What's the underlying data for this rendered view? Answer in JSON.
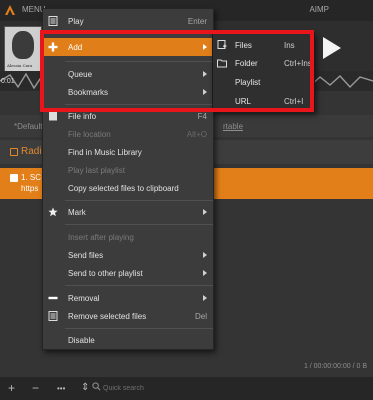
{
  "topbar": {
    "menu_label": "MENU",
    "brand": "AIMP"
  },
  "player": {
    "cover_caption": "Alessia Cara",
    "time_elapsed": "0:01"
  },
  "playlist": {
    "default_tab": "*Default",
    "default_right": "rtable",
    "radio_header": "Radi",
    "track_line1": "1. SC",
    "track_line2": "https"
  },
  "status": {
    "summary": "1 / 00:00:00:00 / 0 B"
  },
  "bottombar": {
    "add": "+",
    "remove": "−",
    "more": "•••",
    "sort": "⇕",
    "search_placeholder": "Quick search"
  },
  "context_menu": {
    "play": {
      "label": "Play",
      "shortcut": "Enter"
    },
    "add": {
      "label": "Add"
    },
    "queue": {
      "label": "Queue"
    },
    "bookmarks": {
      "label": "Bookmarks"
    },
    "file_info": {
      "label": "File info",
      "shortcut": "F4"
    },
    "file_location": {
      "label": "File location",
      "shortcut": "Alt+O"
    },
    "find_library": {
      "label": "Find in Music Library"
    },
    "play_last": {
      "label": "Play last playlist"
    },
    "copy_clipboard": {
      "label": "Copy selected files to clipboard"
    },
    "mark": {
      "label": "Mark"
    },
    "insert_after": {
      "label": "Insert after playing"
    },
    "send_files": {
      "label": "Send files"
    },
    "send_other": {
      "label": "Send to other playlist"
    },
    "removal": {
      "label": "Removal"
    },
    "remove_selected": {
      "label": "Remove selected files",
      "shortcut": "Del"
    },
    "disable": {
      "label": "Disable"
    }
  },
  "add_submenu": {
    "files": {
      "label": "Files",
      "shortcut": "Ins"
    },
    "folder": {
      "label": "Folder",
      "shortcut": "Ctrl+Ins"
    },
    "playlist": {
      "label": "Playlist"
    },
    "url": {
      "label": "URL",
      "shortcut": "Ctrl+I"
    }
  },
  "colors": {
    "accent": "#e07e1a",
    "highlight_border": "#e8161b",
    "background": "#343434"
  },
  "icons": [
    "logo-icon",
    "play-icon",
    "add-plus-icon",
    "file-info-icon",
    "mark-star-icon",
    "removal-minus-icon",
    "remove-files-icon",
    "files-icon",
    "folder-icon",
    "search-icon"
  ]
}
